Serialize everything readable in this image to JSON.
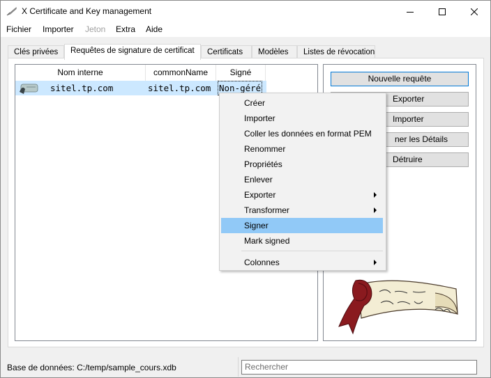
{
  "window": {
    "title": "X Certificate and Key management",
    "icon": "feather-pen-icon"
  },
  "menubar": {
    "items": [
      {
        "label": "Fichier",
        "disabled": false
      },
      {
        "label": "Importer",
        "disabled": false
      },
      {
        "label": "Jeton",
        "disabled": true
      },
      {
        "label": "Extra",
        "disabled": false
      },
      {
        "label": "Aide",
        "disabled": false
      }
    ]
  },
  "tabs": [
    {
      "label": "Clés privées",
      "active": false
    },
    {
      "label": "Requêtes de signature de certificat",
      "active": true
    },
    {
      "label": "Certificats",
      "active": false
    },
    {
      "label": "Modèles",
      "active": false
    },
    {
      "label": "Listes de révocation",
      "active": false
    }
  ],
  "list": {
    "columns": [
      "Nom interne",
      "commonName",
      "Signé"
    ],
    "rows": [
      {
        "icon": "scroll-icon",
        "internal_name": "sitel.tp.com",
        "common_name": "sitel.tp.com",
        "signed": "Non-géré"
      }
    ]
  },
  "buttons": {
    "new_request": "Nouvelle requête",
    "export": "Exporter",
    "import": "Importer",
    "details": "ner les Détails",
    "destroy": "Détruire"
  },
  "context_menu": {
    "items": [
      {
        "label": "Créer",
        "submenu": false,
        "highlighted": false
      },
      {
        "label": "Importer",
        "submenu": false,
        "highlighted": false
      },
      {
        "label": "Coller les données en format PEM",
        "submenu": false,
        "highlighted": false
      },
      {
        "label": "Renommer",
        "submenu": false,
        "highlighted": false
      },
      {
        "label": "Propriétés",
        "submenu": false,
        "highlighted": false
      },
      {
        "label": "Enlever",
        "submenu": false,
        "highlighted": false
      },
      {
        "label": "Exporter",
        "submenu": true,
        "highlighted": false
      },
      {
        "label": "Transformer",
        "submenu": true,
        "highlighted": false
      },
      {
        "label": "Signer",
        "submenu": false,
        "highlighted": true
      },
      {
        "label": "Mark signed",
        "submenu": false,
        "highlighted": false
      }
    ],
    "after_separator": {
      "label": "Colonnes",
      "submenu": true
    }
  },
  "statusbar": {
    "database": "Base de données: C:/temp/sample_cours.xdb",
    "search_placeholder": "Rechercher"
  },
  "colors": {
    "selection": "#cce8ff",
    "menu_highlight": "#91c9f7",
    "button_face": "#e1e1e1"
  }
}
